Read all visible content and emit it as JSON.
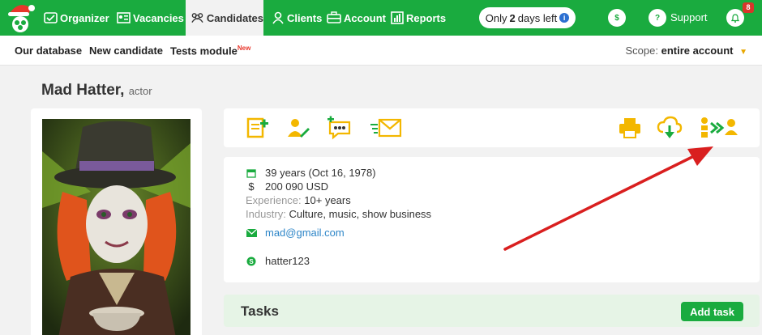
{
  "nav": {
    "items": [
      {
        "label": "Organizer"
      },
      {
        "label": "Vacancies"
      },
      {
        "label": "Candidates"
      },
      {
        "label": "Clients"
      },
      {
        "label": "Account"
      },
      {
        "label": "Reports"
      }
    ],
    "trial_prefix": "Only",
    "trial_days": "2",
    "trial_suffix": "days left",
    "dollar_icon": "$",
    "support_icon": "?",
    "support_label": "Support",
    "notifications_count": "8"
  },
  "subnav": {
    "items": [
      {
        "label": "Our database"
      },
      {
        "label": "New candidate"
      },
      {
        "label": "Tests module"
      }
    ],
    "new_badge": "New",
    "scope_label": "Scope:",
    "scope_value": "entire account"
  },
  "candidate": {
    "name": "Mad Hatter,",
    "role": "actor",
    "age": "39 years (Oct 16, 1978)",
    "salary": "200 090 USD",
    "experience_label": "Experience:",
    "experience_value": "10+ years",
    "industry_label": "Industry:",
    "industry_value": "Culture, music, show business",
    "email": "mad@gmail.com",
    "skype": "hatter123"
  },
  "tasks": {
    "title": "Tasks",
    "add_label": "Add task"
  },
  "colors": {
    "brand_green": "#1aab3f",
    "icon_yellow": "#f3b700",
    "arrow_red": "#d91f1f",
    "link_blue": "#2e86c8"
  }
}
